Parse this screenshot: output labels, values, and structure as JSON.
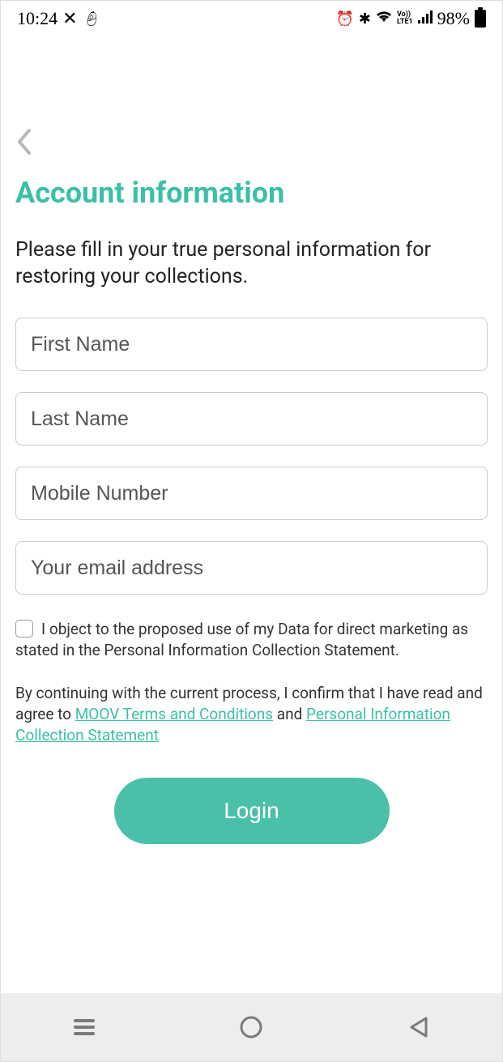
{
  "statusBar": {
    "time": "10:24",
    "battery": "98%"
  },
  "page": {
    "title": "Account information",
    "instruction": "Please fill in your true personal information for restoring your collections."
  },
  "fields": {
    "firstName": {
      "placeholder": "First Name",
      "value": ""
    },
    "lastName": {
      "placeholder": "Last Name",
      "value": ""
    },
    "mobile": {
      "placeholder": "Mobile Number",
      "value": ""
    },
    "email": {
      "placeholder": "Your email address",
      "value": ""
    }
  },
  "checkbox": {
    "label": "I object to the proposed use of my Data for direct marketing as stated in the Personal Information Collection Statement.",
    "checked": false
  },
  "legal": {
    "prefix": "By continuing with the current process, I confirm that I have read and agree to ",
    "termsLabel": "MOOV Terms and Conditions",
    "and": "  and  ",
    "picsLabel": "Personal Information Collection Statement"
  },
  "loginButton": "Login"
}
